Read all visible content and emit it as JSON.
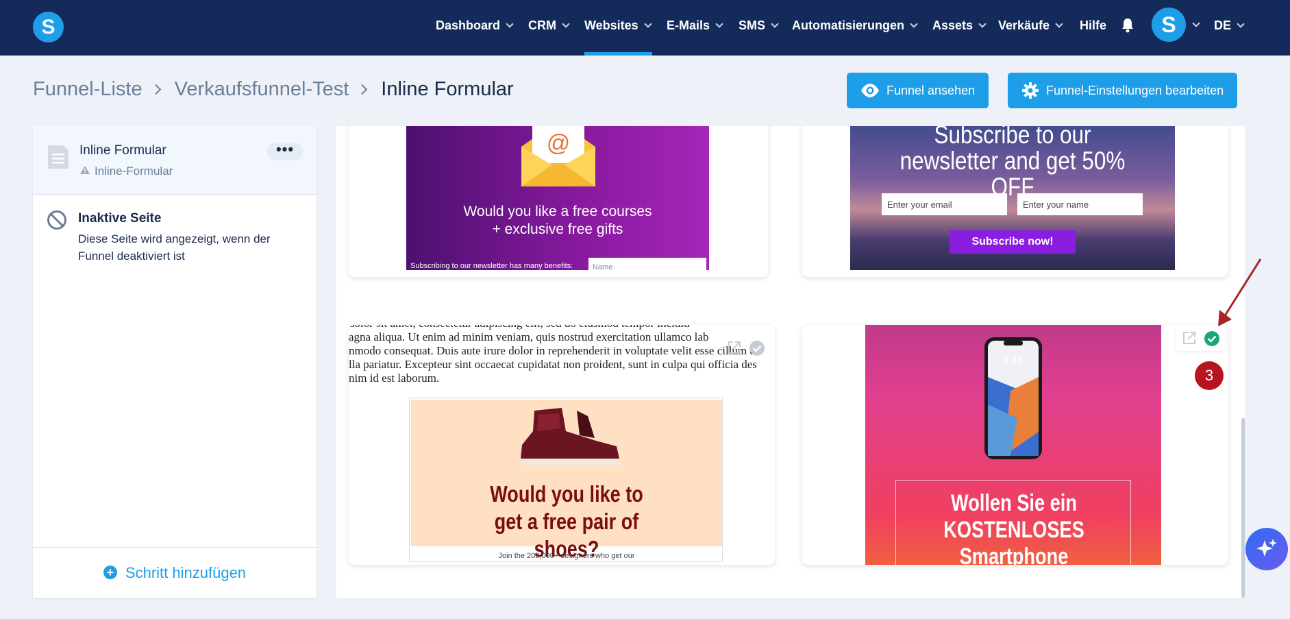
{
  "nav": {
    "logo": "S",
    "items": [
      "Dashboard",
      "CRM",
      "Websites",
      "E-Mails",
      "SMS",
      "Automatisierungen",
      "Assets",
      "Verkäufe"
    ],
    "help": "Hilfe",
    "avatar": "S",
    "lang": "DE",
    "active": "Websites"
  },
  "breadcrumb": {
    "items": [
      "Funnel-Liste",
      "Verkaufsfunnel-Test",
      "Inline Formular"
    ]
  },
  "actions": {
    "view": "Funnel ansehen",
    "settings": "Funnel-Einstellungen bearbeiten"
  },
  "sidebar": {
    "step": {
      "title": "Inline Formular",
      "subtitle": "Inline-Formular",
      "menu": "•••"
    },
    "inactive": {
      "title": "Inaktive Seite",
      "description": "Diese Seite wird angezeigt, wenn der Funnel deaktiviert ist"
    },
    "add_step": "Schritt hinzufügen"
  },
  "templates": {
    "t1": {
      "headline": "Would you like a free courses + exclusive free gifts",
      "footer": "Subscribing to our newsletter has many benefits:",
      "input_placeholder": "Name"
    },
    "t2": {
      "headline": "Subscribe to our newsletter and get 50% OFF",
      "email_placeholder": "Enter your email",
      "name_placeholder": "Enter your name",
      "button": "Subscribe now!"
    },
    "t3": {
      "lorem": [
        "dolor sit amet, consectetur adipiscing elit, sed do eiusmod tempor incidid",
        "agna aliqua. Ut enim ad minim veniam, quis nostrud exercitation ullamco lab",
        "nmodo consequat. Duis aute irure dolor in reprehenderit in voluptate velit esse cillum d",
        "lla pariatur. Excepteur sint occaecat cupidatat non proident, sunt in culpa qui officia des",
        "nim id est laborum."
      ],
      "headline": "Would you like to get a free pair of shoes?",
      "footer": "Join the 200,000+ designers who get our"
    },
    "t4": {
      "headline": "Wollen Sie ein KOSTENLOSES Smartphone gewinnen?",
      "phone_time": "9:41"
    }
  },
  "badge": "3",
  "colors": {
    "nav_bg": "#142a5a",
    "accent": "#1e9ee8",
    "success": "#1aa676",
    "badge": "#b8141e"
  }
}
